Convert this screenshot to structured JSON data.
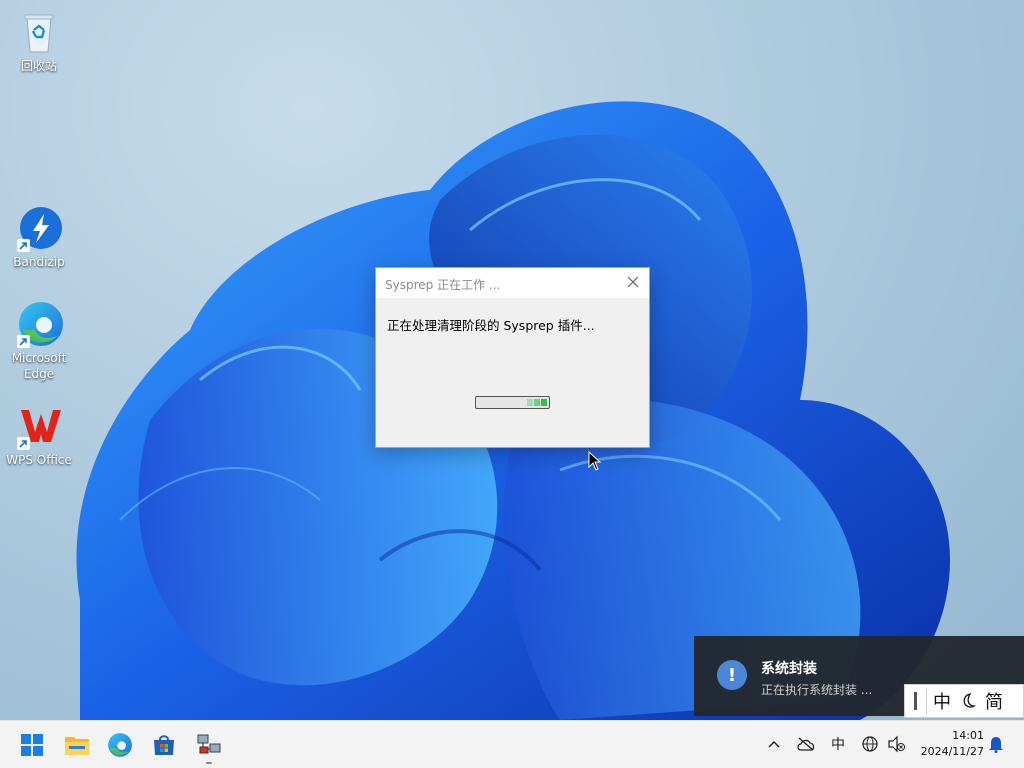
{
  "desktop": {
    "icons": [
      {
        "label": "回收站",
        "icon": "recycle-bin-icon"
      },
      {
        "label": "Bandizip",
        "icon": "bandizip-icon"
      },
      {
        "label": "Microsoft Edge",
        "icon": "edge-icon"
      },
      {
        "label": "WPS Office",
        "icon": "wps-office-icon"
      }
    ]
  },
  "dialog": {
    "title": "Sysprep 正在工作 ...",
    "message": "正在处理清理阶段的 Sysprep 插件...",
    "close_icon": "close-icon",
    "progress_color": "#26c64a"
  },
  "toast": {
    "icon": "exclamation-icon",
    "title": "系统封装",
    "body": "正在执行系统封装 ..."
  },
  "ime": {
    "mode": "中",
    "width_mode_icon": "moon-icon",
    "script": "简"
  },
  "taskbar": {
    "apps": [
      "start-icon",
      "file-explorer-icon",
      "edge-icon",
      "microsoft-store-icon",
      "network-admin-icon"
    ],
    "tray": {
      "chevron_icon": "chevron-up-icon",
      "onedrive_icon": "cloud-offline-icon",
      "ime_indicator": "中",
      "network_icon": "network-globe-icon",
      "volume_icon": "volume-muted-icon",
      "notification_icon": "bell-icon"
    },
    "time": "14:01",
    "date": "2024/11/27"
  },
  "colors": {
    "accent": "#0067c0",
    "wallpaper_blue": "#1a5fe0",
    "toast_bg": "#22282e"
  }
}
